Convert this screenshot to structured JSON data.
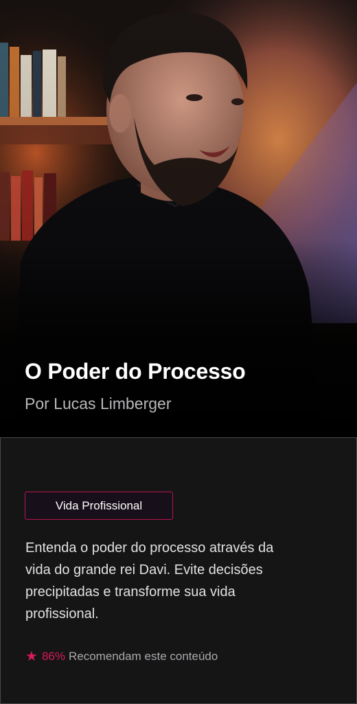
{
  "course": {
    "title": "O Poder do Processo",
    "author": "Por Lucas Limberger",
    "category": "Vida Profissional",
    "description": "Entenda o poder do processo através da vida do grande rei Davi. Evite decisões precipitadas e transforme sua vida profissional.",
    "rating": {
      "icon": "star-icon",
      "percent": "86%",
      "label": "Recomendam este conteúdo"
    }
  },
  "colors": {
    "accent": "#d81b5b",
    "card_background": "#151516",
    "page_background": "#000000"
  }
}
